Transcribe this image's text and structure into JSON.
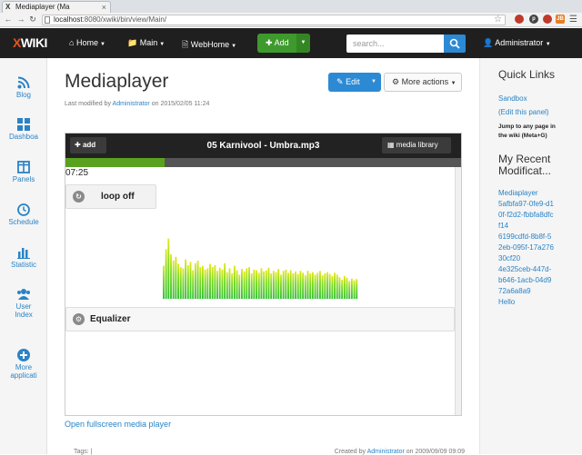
{
  "browser": {
    "tab_logo": "X",
    "tab_title": "Mediaplayer (Ma",
    "tab_close": "×",
    "url_host": "localhost",
    "url_path": ":8080/xwiki/bin/view/Main/",
    "ext_badges": [
      "",
      "p",
      "JB",
      ""
    ]
  },
  "navbar": {
    "logo_mark": "X",
    "logo_text": "WIKI",
    "items": [
      {
        "label": "Home"
      },
      {
        "label": "Main"
      },
      {
        "label": "WebHome"
      }
    ],
    "add_label": "Add",
    "search_placeholder": "search...",
    "user": "Administrator"
  },
  "appbar": {
    "apps": [
      {
        "label": "Blog",
        "icon": "rss-icon"
      },
      {
        "label": "Dashboa",
        "icon": "dashboard-icon"
      },
      {
        "label": "Panels",
        "icon": "panels-icon"
      },
      {
        "label": "Schedule",
        "icon": "clock-icon"
      },
      {
        "label": "Statistic",
        "icon": "bar-chart-icon"
      },
      {
        "label": "User",
        "label2": "Index",
        "icon": "users-icon"
      },
      {
        "label": "More",
        "label2": "applicati",
        "icon": "plus-circle-icon"
      }
    ]
  },
  "page": {
    "title": "Mediaplayer",
    "modified_prefix": "Last modified by ",
    "modified_user": "Administrator",
    "modified_date": " on 2015/02/05 11:24",
    "edit_label": "Edit",
    "more_actions_label": "More actions"
  },
  "player": {
    "add_label": "add",
    "track_title": "05 Karnivool - Umbra.mp3",
    "library_label": "media library",
    "progress": 0.25,
    "time": "07:25",
    "loop_label": "loop off",
    "equalizer_label": "Equalizer",
    "spectrum": [
      0.52,
      0.78,
      0.95,
      0.7,
      0.6,
      0.66,
      0.55,
      0.5,
      0.48,
      0.62,
      0.53,
      0.58,
      0.45,
      0.56,
      0.6,
      0.5,
      0.52,
      0.46,
      0.48,
      0.55,
      0.5,
      0.53,
      0.44,
      0.49,
      0.46,
      0.56,
      0.42,
      0.48,
      0.4,
      0.52,
      0.45,
      0.38,
      0.47,
      0.43,
      0.48,
      0.5,
      0.4,
      0.46,
      0.45,
      0.41,
      0.48,
      0.43,
      0.45,
      0.49,
      0.4,
      0.44,
      0.42,
      0.47,
      0.38,
      0.44,
      0.46,
      0.41,
      0.45,
      0.4,
      0.43,
      0.39,
      0.44,
      0.41,
      0.37,
      0.44,
      0.4,
      0.42,
      0.38,
      0.41,
      0.44,
      0.37,
      0.4,
      0.42,
      0.39,
      0.36,
      0.41,
      0.38,
      0.34,
      0.3,
      0.36,
      0.33,
      0.28,
      0.32,
      0.29,
      0.31
    ],
    "fullscreen_link": "Open fullscreen media player"
  },
  "footer": {
    "left": "Tags: | ",
    "right_prefix": "Created by ",
    "right_user": "Administrator",
    "right_date": " on 2009/09/09 09:09"
  },
  "right_panel": {
    "quick_links_title": "Quick Links",
    "quick_links": [
      "Sandbox",
      "(Edit this panel)"
    ],
    "jump_text": "Jump to any page in the wiki (Meta+G)",
    "recent_title": "My Recent Modificat...",
    "recent_items": [
      "Mediaplayer",
      "5afbfa97-0fe9-d10f-f2d2-fbbfa8dfcf14",
      "6199cdfd-8b8f-52eb-095f-17a27630cf20",
      "4e325ceb-447d-b646-1acb-04d972a6a8a9",
      "Hello"
    ]
  },
  "colors": {
    "accent": "#2c8ad4",
    "success": "#3e9a2c",
    "navbar_bg": "#1f1f1f",
    "progress": "#5aa11e"
  }
}
